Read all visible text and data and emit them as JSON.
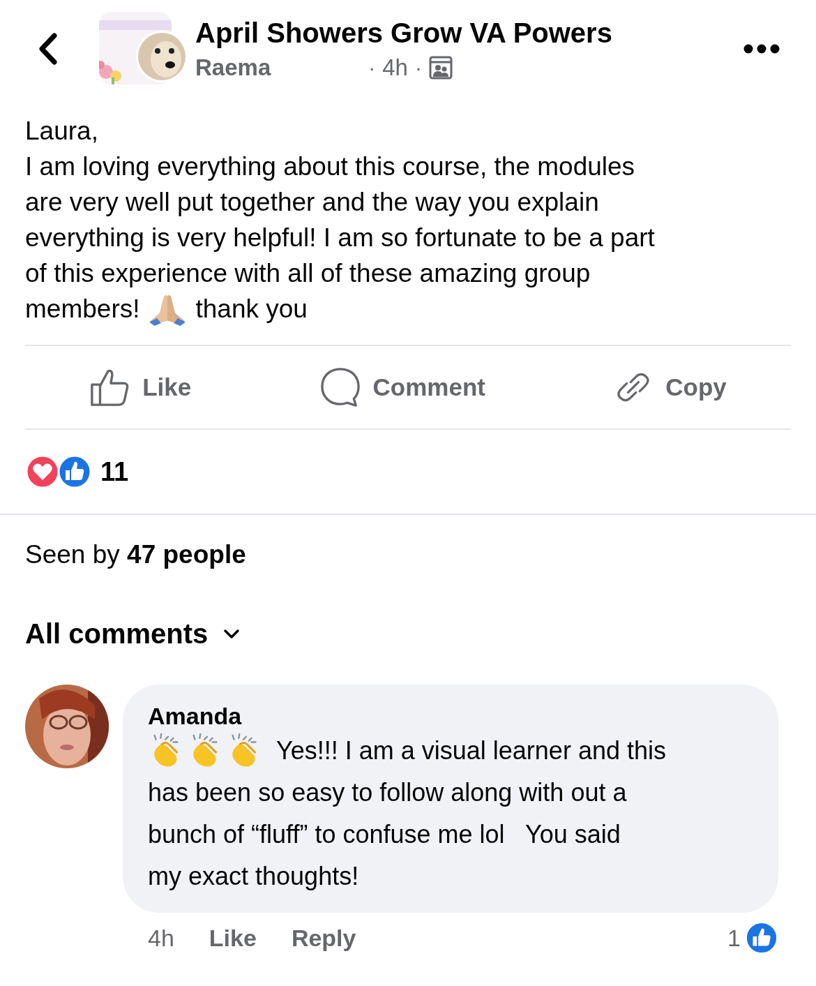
{
  "header": {
    "group_name": "April Showers Grow VA Powers",
    "author": "Raema",
    "time": "4h",
    "separator": "·"
  },
  "post": {
    "lines": [
      [
        {
          "kind": "text",
          "text": "Laura,"
        }
      ],
      [
        {
          "kind": "text",
          "text": "I am loving everything about this course, the modules"
        }
      ],
      [
        {
          "kind": "text",
          "text": "are very well put together and the way you explain"
        }
      ],
      [
        {
          "kind": "text",
          "text": "everything is very helpful! I am so fortunate to be a part"
        }
      ],
      [
        {
          "kind": "text",
          "text": "of this experience with all of these amazing group"
        }
      ],
      [
        {
          "kind": "text",
          "text": "members!"
        },
        {
          "kind": "praying-hands"
        },
        {
          "kind": "text",
          "text": "thank you"
        }
      ]
    ]
  },
  "actions": [
    {
      "kind": "like",
      "label": "Like"
    },
    {
      "kind": "comment",
      "label": "Comment"
    },
    {
      "kind": "copy",
      "label": "Copy"
    }
  ],
  "reactions": {
    "icons": [
      {
        "kind": "love"
      },
      {
        "kind": "like"
      }
    ],
    "count": "11"
  },
  "seen_by": "Seen by **47 people**",
  "comments_filter": {
    "label": "All comments"
  },
  "comments": [
    {
      "author": "Amanda",
      "lines": [
        [
          {
            "kind": "clapping-hands"
          },
          {
            "kind": "clapping-hands"
          },
          {
            "kind": "clapping-hands"
          },
          {
            "kind": "text",
            "text": "Yes!!! I am a visual learner and this"
          }
        ],
        [
          {
            "kind": "text",
            "text": "has been so easy to follow along with out a"
          }
        ],
        [
          {
            "kind": "text",
            "text": "bunch of “fluff” to confuse me lol   You said"
          }
        ],
        [
          {
            "kind": "text",
            "text": "my exact thoughts!"
          }
        ]
      ],
      "time": "4h",
      "like_label": "Like",
      "reply_label": "Reply",
      "like_count": "1"
    }
  ]
}
